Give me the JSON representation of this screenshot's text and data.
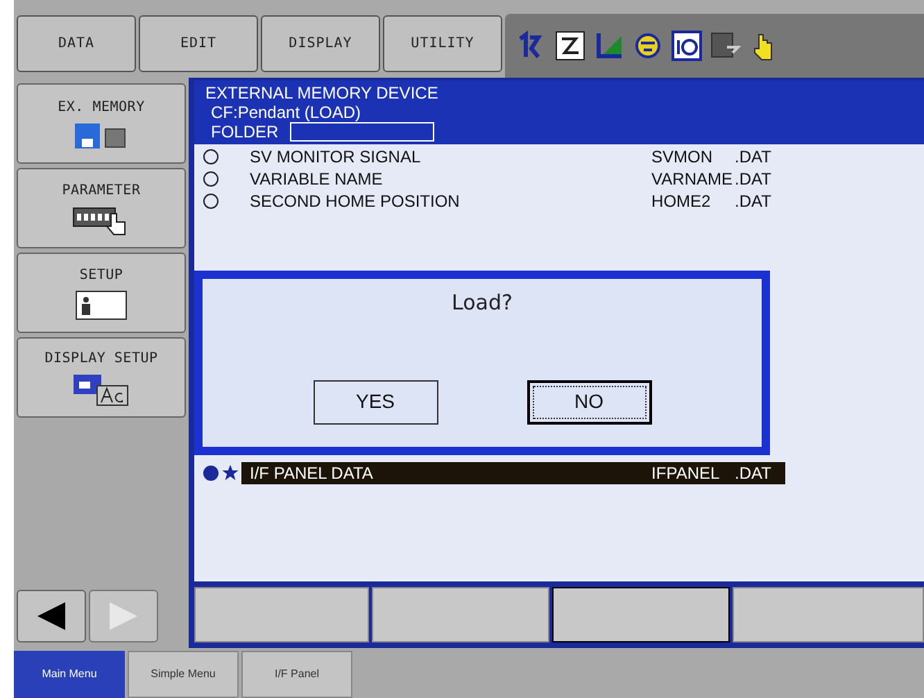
{
  "menu_tabs": [
    {
      "label": "DATA"
    },
    {
      "label": "EDIT"
    },
    {
      "label": "DISPLAY"
    },
    {
      "label": "UTILITY"
    }
  ],
  "sidebar": {
    "items": [
      {
        "label": "EX. MEMORY",
        "kind": "memory"
      },
      {
        "label": "PARAMETER",
        "kind": "parameter"
      },
      {
        "label": "SETUP",
        "kind": "setup"
      },
      {
        "label": "DISPLAY SETUP",
        "kind": "display"
      }
    ]
  },
  "panel": {
    "title": "EXTERNAL MEMORY DEVICE",
    "device": "CF:Pendant (LOAD)",
    "folder_label": "FOLDER",
    "rows": [
      {
        "name": "SV MONITOR SIGNAL",
        "file": "SVMON",
        "ext": ".DAT",
        "checked": false,
        "starred": false,
        "selected": false
      },
      {
        "name": "VARIABLE NAME",
        "file": "VARNAME",
        "ext": ".DAT",
        "checked": false,
        "starred": false,
        "selected": false
      },
      {
        "name": "SECOND HOME POSITION",
        "file": "HOME2",
        "ext": ".DAT",
        "checked": false,
        "starred": false,
        "selected": false
      }
    ],
    "last_row": {
      "name": "I/F PANEL DATA",
      "file": "IFPANEL",
      "ext": ".DAT",
      "checked": true,
      "starred": true,
      "selected": true
    }
  },
  "dialog": {
    "message": "Load?",
    "buttons": [
      {
        "label": "YES",
        "focused": false
      },
      {
        "label": "NO",
        "focused": true
      }
    ]
  },
  "bottom_tabs": [
    {
      "label": "Main Menu",
      "selected": true
    },
    {
      "label": "Simple Menu",
      "selected": false
    },
    {
      "label": "I/F Panel",
      "selected": false
    }
  ]
}
